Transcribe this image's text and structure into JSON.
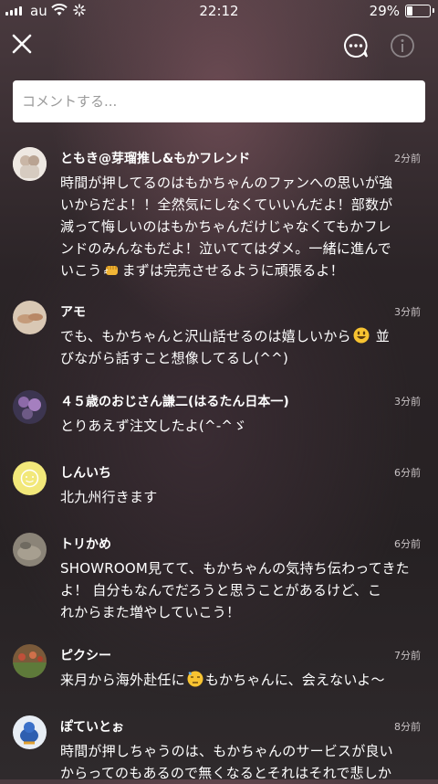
{
  "status_bar": {
    "carrier": "au",
    "time": "22:12",
    "battery": "29%",
    "battery_level": 0.29
  },
  "header": {
    "close_icon": "close-icon",
    "chat_icon": "chat-bubble-icon",
    "info_icon": "info-icon"
  },
  "search": {
    "placeholder": "コメントする..."
  },
  "colors": {
    "background": "#2b2427",
    "text": "#ffffff",
    "time": "#c9c3c5"
  },
  "comments": [
    {
      "name": "ともき@芽瑠推し&もかフレンド",
      "time": "2分前",
      "lines": [
        "時間が押してるのはもかちゃんのファンへの思いが強",
        "いからだよ！！全然気にしなくていいんだよ！部数が",
        "減って悔しいのはもかちゃんだけじゃなくてもかフレ",
        "ンドのみんなもだよ！泣いててはダメ。一緒に進んで",
        "いこう",
        "まずは完売させるように頑張るよ！"
      ]
    },
    {
      "name": "アモ",
      "time": "3分前",
      "lines": [
        "でも、もかちゃんと沢山話せるのは嬉しいから",
        " 並",
        "びながら話すこと想像してるし(^^)"
      ]
    },
    {
      "name": "４５歳のおじさん謙二(はるたん日本一)",
      "time": "3分前",
      "lines": [
        "とりあえず注文したよ(^-^ゞ"
      ]
    },
    {
      "name": "しんいち",
      "time": "6分前",
      "lines": [
        "北九州行きます"
      ]
    },
    {
      "name": "トリかめ",
      "time": "6分前",
      "lines": [
        "SHOWROOM見てて、もかちゃんの気持ち伝わってきた",
        "よ！ 自分もなんでだろうと思うことがあるけど、こ",
        "れからまた増やしていこう！"
      ]
    },
    {
      "name": "ピクシー",
      "time": "7分前",
      "lines": [
        "来月から海外赴任に",
        "もかちゃんに、会えないよ〜"
      ]
    },
    {
      "name": "ぽていとぉ",
      "time": "8分前",
      "lines": [
        "時間が押しちゃうのは、もかちゃんのサービスが良い",
        "からってのもあるので無くなるとそれはそれで悲しか"
      ]
    }
  ]
}
